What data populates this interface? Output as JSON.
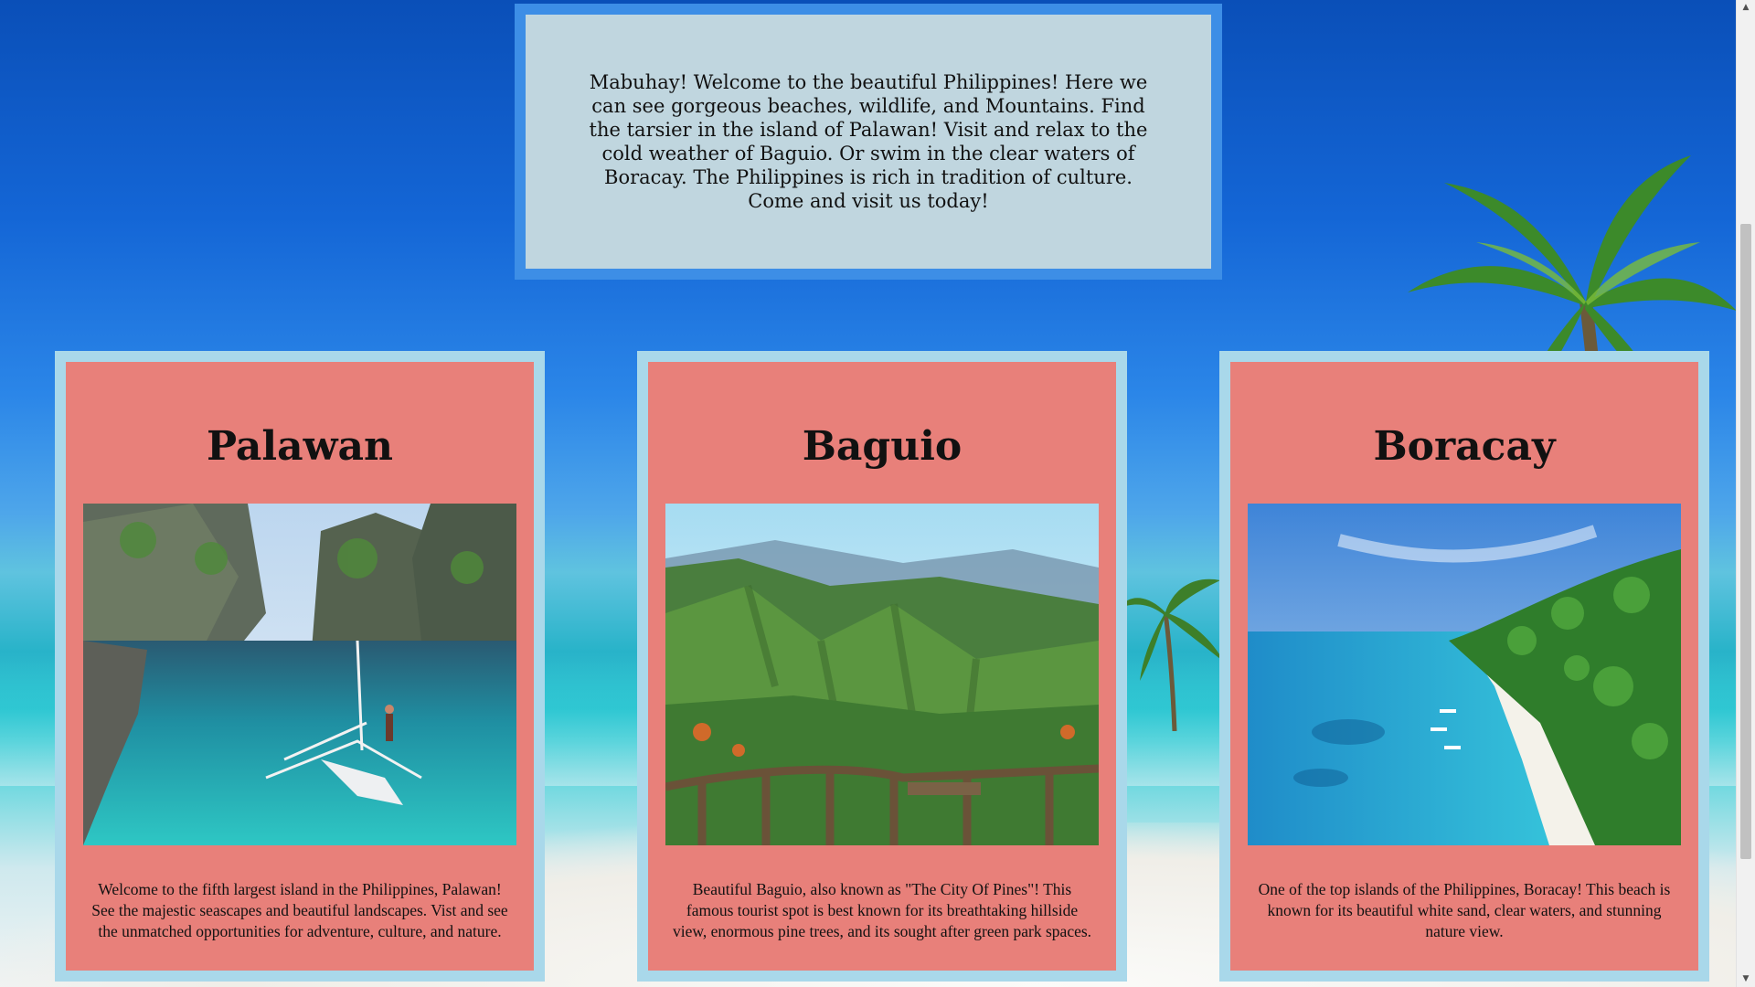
{
  "welcome": {
    "text": "Mabuhay! Welcome to the beautiful Philippines! Here we can see gorgeous beaches, wildlife, and Mountains. Find the tarsier in the island of Palawan! Visit and relax to the cold weather of Baguio. Or swim in the clear waters of Boracay. The Philippines is rich in tradition of culture. Come and visit us today!"
  },
  "cards": [
    {
      "title": "Palawan",
      "description": "Welcome to the fifth largest island in the Philippines, Palawan! See the majestic seascapes and beautiful landscapes. Vist and see the unmatched opportunities for adventure, culture, and nature."
    },
    {
      "title": "Baguio",
      "description": "Beautiful Baguio, also known as \"The City Of Pines\"! This famous tourist spot is best known for its breathtaking hillside view, enormous pine trees, and its sought after green park spaces."
    },
    {
      "title": "Boracay",
      "description": "One of the top islands of the Philippines, Boracay! This beach is known for its beautiful white sand, clear waters, and stunning nature view."
    }
  ],
  "colors": {
    "welcome_bg": "#c0d6df",
    "welcome_border": "#3d8ee6",
    "card_bg": "#e8807a",
    "card_border": "#a9d8ea"
  },
  "scrollbar": {
    "up_icon": "chevron-up-icon",
    "down_icon": "chevron-down-icon"
  }
}
